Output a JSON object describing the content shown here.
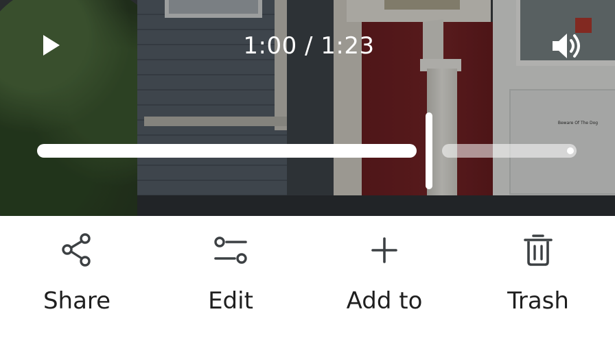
{
  "player": {
    "time_display": "1:00 / 1:23",
    "progress_fraction": 0.723,
    "state": "paused",
    "play_icon": "play-icon",
    "volume_icon": "volume-icon",
    "scene_sign_text": "Beware Of The Dog"
  },
  "actions": [
    {
      "label": "Share",
      "icon": "share-icon"
    },
    {
      "label": "Edit",
      "icon": "edit-sliders-icon"
    },
    {
      "label": "Add to",
      "icon": "plus-icon"
    },
    {
      "label": "Trash",
      "icon": "trash-icon"
    }
  ],
  "colors": {
    "overlay_text": "#ffffff",
    "action_text": "#1f1f1f",
    "icon_stroke": "#3c4043",
    "background": "#ffffff"
  }
}
